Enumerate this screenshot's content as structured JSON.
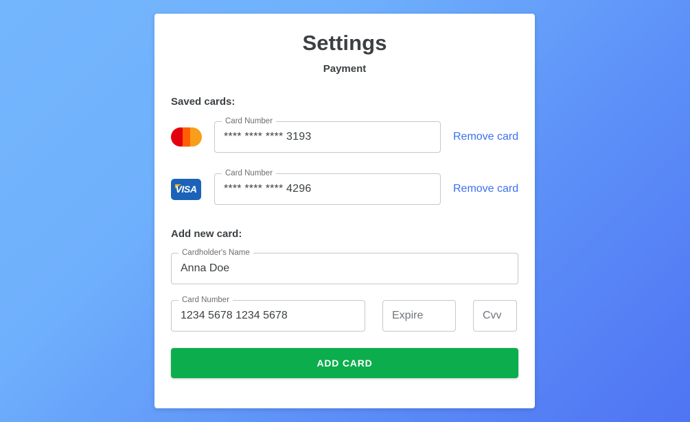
{
  "header": {
    "title": "Settings",
    "subtitle": "Payment"
  },
  "saved_cards": {
    "heading": "Saved cards:",
    "items": [
      {
        "brand": "mastercard-logo",
        "field_label": "Card Number",
        "value": "**** **** **** 3193",
        "remove_label": "Remove card"
      },
      {
        "brand": "visa-logo",
        "brand_text": "VISA",
        "field_label": "Card Number",
        "value": "**** **** **** 4296",
        "remove_label": "Remove card"
      }
    ]
  },
  "add_new_card": {
    "heading": "Add new card:",
    "name_field": {
      "label": "Cardholder's Name",
      "value": "Anna Doe"
    },
    "number_field": {
      "label": "Card Number",
      "value": "1234 5678 1234 5678"
    },
    "expire_field": {
      "placeholder": "Expire",
      "value": ""
    },
    "cvv_field": {
      "placeholder": "Cvv",
      "value": ""
    },
    "submit_label": "ADD CARD"
  },
  "colors": {
    "accent_green": "#0cad4d",
    "link_blue": "#3b6fee",
    "background_from": "#74b6fd",
    "background_to": "#4f74f3",
    "mastercard_red": "#e3000f",
    "mastercard_orange": "#f79e1b",
    "visa_blue": "#1b62b8",
    "visa_gold": "#f2b01e"
  }
}
